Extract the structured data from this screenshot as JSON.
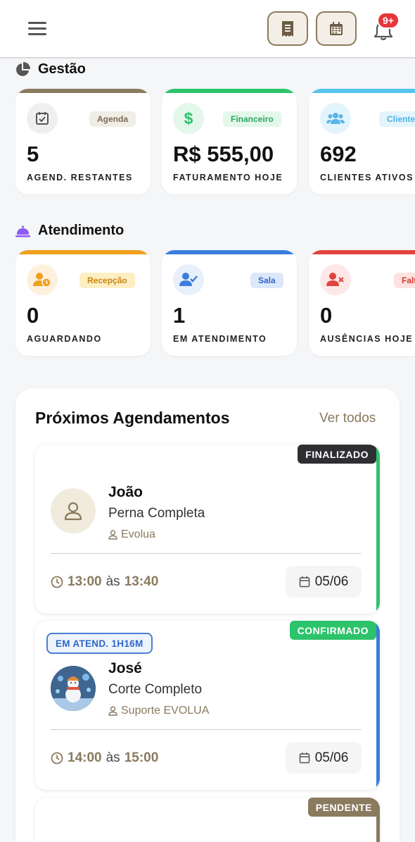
{
  "header": {
    "menu_icon": "hamburger-menu-icon",
    "receipt_icon": "receipt-icon",
    "calendar_icon": "calendar-icon",
    "bell_icon": "bell-icon",
    "notification_count": "9+"
  },
  "gestao": {
    "title": "Gestão",
    "cards": [
      {
        "tag": "Agenda",
        "value": "5",
        "label": "AGEND. RESTANTES",
        "icon": "calendar-check-icon",
        "color": "#8a7a5e"
      },
      {
        "tag": "Financeiro",
        "value": "R$ 555,00",
        "label": "FATURAMENTO HOJE",
        "icon": "dollar-icon",
        "color": "#2cc36b"
      },
      {
        "tag": "Clientes",
        "value": "692",
        "label": "CLIENTES ATIVOS",
        "icon": "users-icon",
        "color": "#57c3ee"
      }
    ]
  },
  "atendimento": {
    "title": "Atendimento",
    "cards": [
      {
        "tag": "Recepção",
        "value": "0",
        "label": "AGUARDANDO",
        "icon": "user-clock-icon",
        "color": "#f0a01e"
      },
      {
        "tag": "Sala",
        "value": "1",
        "label": "EM ATENDIMENTO",
        "icon": "user-check-icon",
        "color": "#3b7ddd"
      },
      {
        "tag": "Faltas",
        "value": "0",
        "label": "AUSÊNCIAS HOJE",
        "icon": "user-x-icon",
        "color": "#e0453f"
      }
    ]
  },
  "appointments": {
    "title": "Próximos Agendamentos",
    "see_all": "Ver todos",
    "items": [
      {
        "status": "FINALIZADO",
        "status_color": "#2f2f33",
        "edge_color": "#2cc36b",
        "client": "João",
        "service": "Perna Completa",
        "professional": "Evolua",
        "start": "13:00",
        "sep": "às",
        "end": "13:40",
        "date": "05/06"
      },
      {
        "status": "CONFIRMADO",
        "status_color": "#2cc36b",
        "edge_color": "#3b7ddd",
        "in_progress": "EM ATEND. 1H16M",
        "client": "José",
        "service": "Corte Completo",
        "professional": "Suporte EVOLUA",
        "start": "14:00",
        "sep": "às",
        "end": "15:00",
        "date": "05/06"
      },
      {
        "status": "PENDENTE",
        "status_color": "#8a7a5e",
        "edge_color": "#8a7a5e"
      }
    ]
  }
}
